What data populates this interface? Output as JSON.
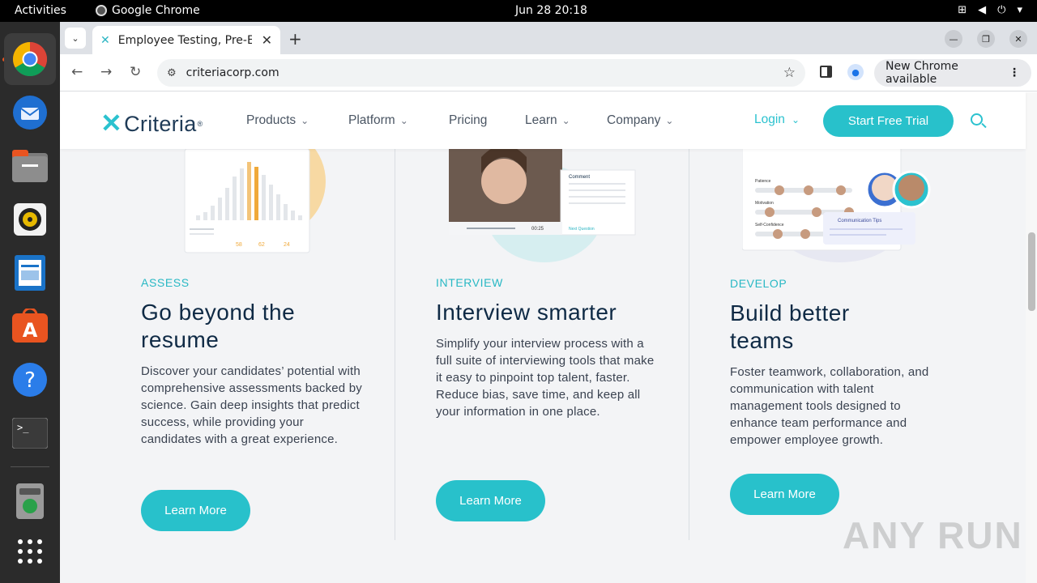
{
  "os": {
    "activities": "Activities",
    "app_name": "Google Chrome",
    "clock": "Jun 28  20:18"
  },
  "browser": {
    "tab_title": "Employee Testing, Pre-E",
    "url": "criteriacorp.com",
    "update_chip": "New Chrome available"
  },
  "site": {
    "logo_text": "Criteria",
    "nav": [
      {
        "label": "Products"
      },
      {
        "label": "Platform"
      },
      {
        "label": "Pricing"
      },
      {
        "label": "Learn"
      },
      {
        "label": "Company"
      }
    ],
    "login": "Login",
    "cta": "Start Free Trial"
  },
  "illustrations": {
    "assess_scores": [
      "58",
      "62",
      "24"
    ],
    "interview_comment": "Comment",
    "interview_time": "00:25",
    "interview_next": "Next Question",
    "develop_tip": "Communication Tips",
    "develop_rows": [
      "Patience",
      "Motivation",
      "Self-Confidence"
    ]
  },
  "columns": [
    {
      "eyebrow": "ASSESS",
      "heading": "Go beyond the resume",
      "body": "Discover your candidates’ potential with comprehensive assessments backed by science. Gain deep insights that predict success, while providing your candidates with a great experience.",
      "button": "Learn More"
    },
    {
      "eyebrow": "INTERVIEW",
      "heading": "Interview smarter",
      "body": "Simplify your interview process with a full suite of interviewing tools that make it easy to pinpoint top talent, faster. Reduce bias, save time, and keep all your information in one place.",
      "button": "Learn More"
    },
    {
      "eyebrow": "DEVELOP",
      "heading": "Build better teams",
      "body": "Foster teamwork, collaboration, and communication with talent management tools designed to enhance team performance and empower employee growth.",
      "button": "Learn More"
    }
  ],
  "watermark": "ANY RUN",
  "colors": {
    "accent": "#28c1cb",
    "heading": "#0f2a45",
    "page_bg": "#f3f4f6"
  }
}
